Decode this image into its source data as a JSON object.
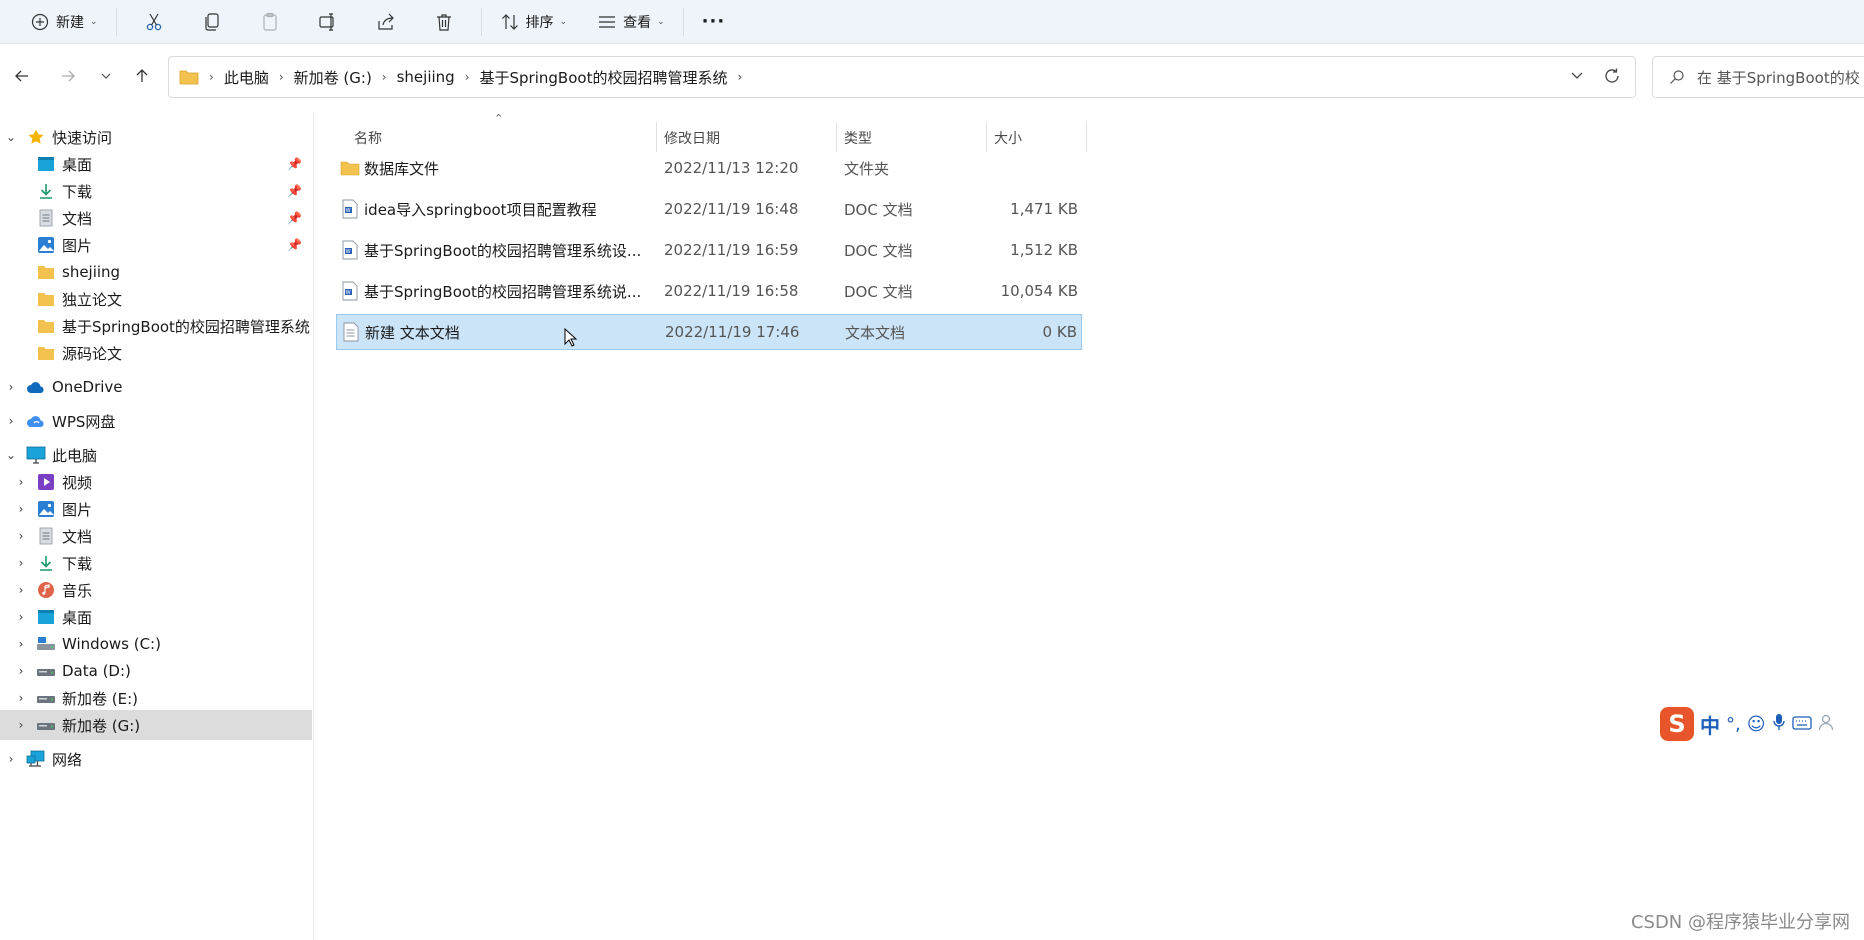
{
  "toolbar": {
    "new_label": "新建",
    "sort_label": "排序",
    "view_label": "查看",
    "more_label": "···"
  },
  "address": {
    "crumbs": [
      "此电脑",
      "新加卷 (G:)",
      "shejiing",
      "基于SpringBoot的校园招聘管理系统"
    ],
    "search_placeholder": "在 基于SpringBoot的校"
  },
  "sidebar": {
    "quick_access": "快速访问",
    "quick_items": [
      {
        "label": "桌面",
        "icon": "desktop-icon",
        "pinned": true
      },
      {
        "label": "下载",
        "icon": "download-icon",
        "pinned": true
      },
      {
        "label": "文档",
        "icon": "document-icon",
        "pinned": true
      },
      {
        "label": "图片",
        "icon": "picture-icon",
        "pinned": true
      },
      {
        "label": "shejiing",
        "icon": "folder-icon",
        "pinned": false
      },
      {
        "label": "独立论文",
        "icon": "folder-icon",
        "pinned": false
      },
      {
        "label": "基于SpringBoot的校园招聘管理系统",
        "icon": "folder-icon",
        "pinned": false
      },
      {
        "label": "源码论文",
        "icon": "folder-icon",
        "pinned": false
      }
    ],
    "onedrive": "OneDrive",
    "wps": "WPS网盘",
    "this_pc": "此电脑",
    "pc_items": [
      {
        "label": "视频",
        "icon": "video-icon"
      },
      {
        "label": "图片",
        "icon": "picture-icon"
      },
      {
        "label": "文档",
        "icon": "document-icon"
      },
      {
        "label": "下载",
        "icon": "download-icon"
      },
      {
        "label": "音乐",
        "icon": "music-icon"
      },
      {
        "label": "桌面",
        "icon": "desktop-icon"
      },
      {
        "label": "Windows (C:)",
        "icon": "drive-icon"
      },
      {
        "label": "Data (D:)",
        "icon": "drive-icon"
      },
      {
        "label": "新加卷 (E:)",
        "icon": "drive-icon"
      },
      {
        "label": "新加卷 (G:)",
        "icon": "drive-icon",
        "selected": true
      }
    ],
    "network": "网络"
  },
  "columns": {
    "name": "名称",
    "date": "修改日期",
    "type": "类型",
    "size": "大小"
  },
  "files": [
    {
      "name": "数据库文件",
      "date": "2022/11/13 12:20",
      "type": "文件夹",
      "size": "",
      "icon": "folder-icon"
    },
    {
      "name": "idea导入springboot项目配置教程",
      "date": "2022/11/19 16:48",
      "type": "DOC 文档",
      "size": "1,471 KB",
      "icon": "doc-icon"
    },
    {
      "name": "基于SpringBoot的校园招聘管理系统设...",
      "date": "2022/11/19 16:59",
      "type": "DOC 文档",
      "size": "1,512 KB",
      "icon": "doc-icon"
    },
    {
      "name": "基于SpringBoot的校园招聘管理系统说...",
      "date": "2022/11/19 16:58",
      "type": "DOC 文档",
      "size": "10,054 KB",
      "icon": "doc-icon"
    },
    {
      "name": "新建 文本文档",
      "date": "2022/11/19 17:46",
      "type": "文本文档",
      "size": "0 KB",
      "icon": "txt-icon",
      "selected": true
    }
  ],
  "ime": {
    "logo": "S",
    "mode": "中",
    "punct": "°,"
  },
  "watermark": "CSDN @程序猿毕业分享网",
  "colors": {
    "toolbar_bg": "#eef4f9",
    "selection_bg": "#cce4f7",
    "selection_border": "#99c9ef",
    "folder": "#f2c14e",
    "nav_selected": "#dcdcdc"
  }
}
